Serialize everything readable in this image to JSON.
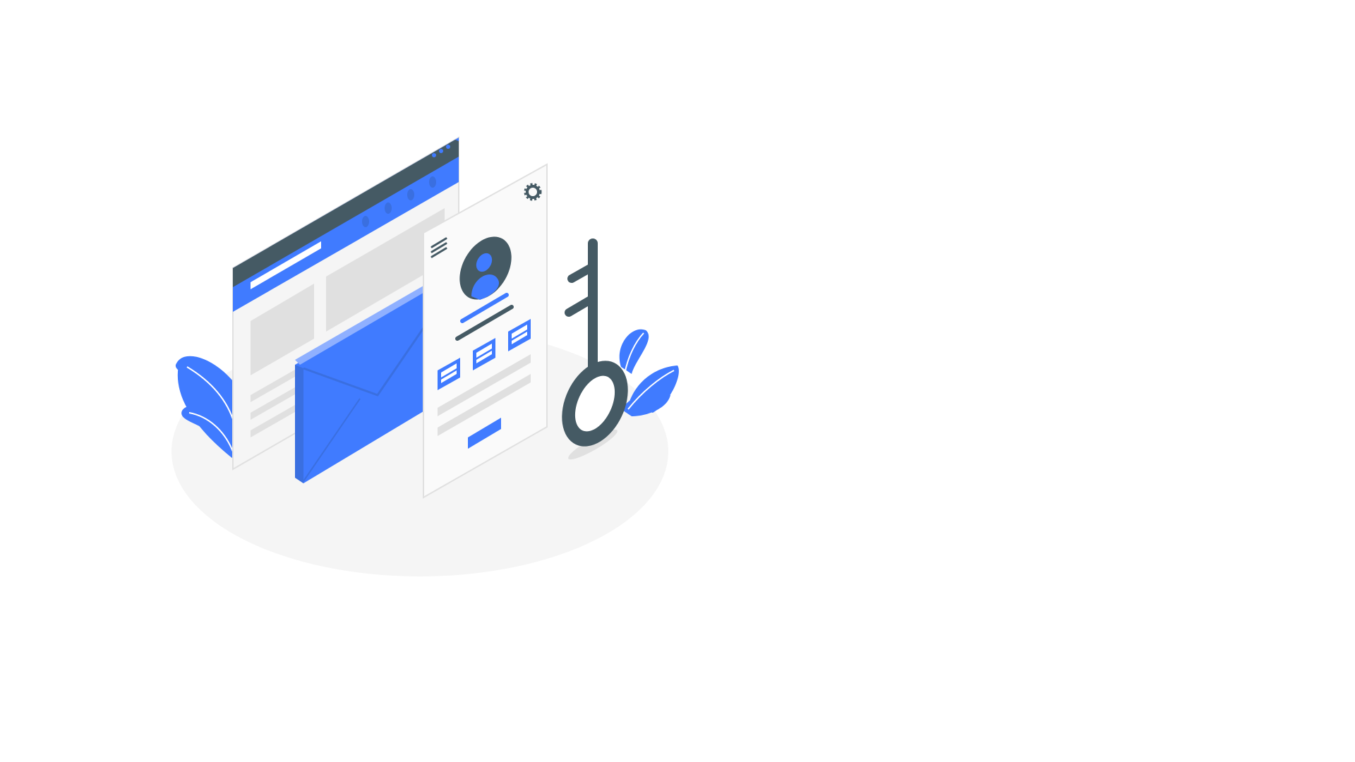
{
  "illustration": {
    "colors": {
      "accent": "#407BFF",
      "accent_light": "#8FB0FF",
      "dark": "#455A64",
      "panel": "#F5F5F5",
      "panel_light": "#FAFAFA",
      "placeholder": "#E0E0E0",
      "ground": "#F5F5F5"
    },
    "icons": [
      "browser-window-icon",
      "envelope-icon",
      "profile-card-icon",
      "avatar-icon",
      "gear-icon",
      "hamburger-menu-icon",
      "key-icon",
      "plant-icon"
    ]
  }
}
